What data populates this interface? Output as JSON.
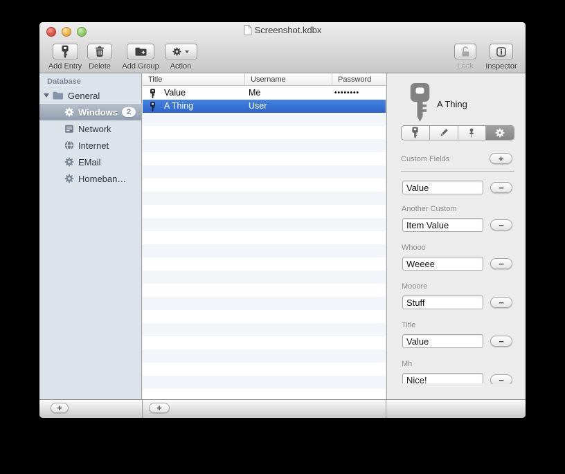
{
  "window_title": "Screenshot.kdbx",
  "toolbar": {
    "add_entry": "Add Entry",
    "delete": "Delete",
    "add_group": "Add Group",
    "action": "Action",
    "lock": "Lock",
    "inspector": "Inspector"
  },
  "icons": {
    "plus": "+",
    "minus": "−"
  },
  "sidebar": {
    "header": "Database",
    "items": [
      {
        "label": "General"
      },
      {
        "label": "Windows",
        "badge": "2"
      },
      {
        "label": "Network"
      },
      {
        "label": "Internet"
      },
      {
        "label": "EMail"
      },
      {
        "label": "Homeban…"
      }
    ]
  },
  "table": {
    "columns": [
      "Title",
      "Username",
      "Password"
    ],
    "rows": [
      {
        "title": "Value",
        "username": "Me",
        "password": "••••••••"
      },
      {
        "title": "A Thing",
        "username": "User",
        "password": ""
      }
    ]
  },
  "inspector": {
    "entry_title": "A Thing",
    "section_title": "Custom Fields",
    "fields": [
      {
        "label": "",
        "value": "Value"
      },
      {
        "label": "Another Custom",
        "value": "Item Value"
      },
      {
        "label": "Whooo",
        "value": "Weeee"
      },
      {
        "label": "Mooore",
        "value": "Stuff"
      },
      {
        "label": "Title",
        "value": "Value"
      },
      {
        "label": "Mh",
        "value": "Nice!"
      }
    ]
  },
  "colors": {
    "selection_blue": "#3572d7",
    "sidebar_selection_grey": "#9aa6b5",
    "sidebar_bg": "#dce3eb",
    "chrome_grey": "#d4d4d4"
  }
}
